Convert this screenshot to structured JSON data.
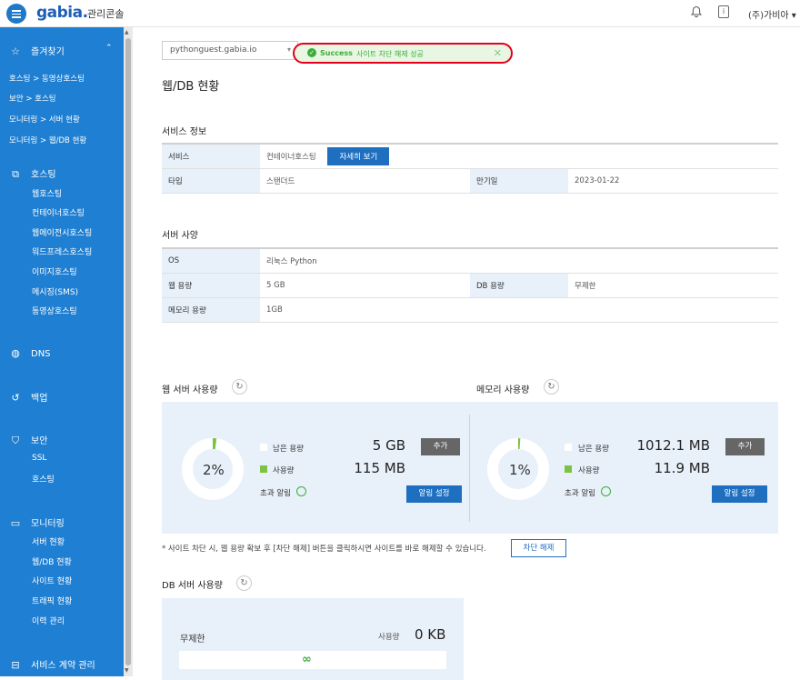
{
  "header": {
    "logo": "gabia.",
    "subtitle": "관리콘솔",
    "bell_icon": "bell-icon",
    "doc_icon": "document-icon",
    "company": "(주)가비아"
  },
  "sidebar": {
    "favorites": {
      "label": "즐겨찾기",
      "items": [
        "호스팅 > 동영상호스팅",
        "보안 > 호스팅",
        "모니터링 > 서버 현황",
        "모니터링 > 웹/DB 현황"
      ]
    },
    "hosting": {
      "label": "호스팅",
      "items": [
        "웹호스팅",
        "컨테이너호스팅",
        "웹에이전시호스팅",
        "워드프레스호스팅",
        "이미지호스팅",
        "메시징(SMS)",
        "동영상호스팅"
      ]
    },
    "dns": {
      "label": "DNS"
    },
    "backup": {
      "label": "백업"
    },
    "security": {
      "label": "보안",
      "items": [
        "SSL",
        "호스팅"
      ]
    },
    "monitoring": {
      "label": "모니터링",
      "items": [
        "서버 현황",
        "웹/DB 현황",
        "사이트 현황",
        "트래픽 현황",
        "이력 관리"
      ]
    },
    "contract": {
      "label": "서비스 계약 관리"
    }
  },
  "main": {
    "domain_select": "pythonguest.gabia.io",
    "toast": {
      "title": "Success",
      "message": "사이트 차단 해제 성공"
    },
    "page_title": "웹/DB 현황",
    "service_info": {
      "title": "서비스 정보",
      "service_label": "서비스",
      "service_value": "컨테이너호스팅",
      "detail_button": "자세히 보기",
      "type_label": "타입",
      "type_value": "스탠더드",
      "expire_label": "만기일",
      "expire_value": "2023-01-22"
    },
    "server_spec": {
      "title": "서버 사양",
      "os_label": "OS",
      "os_value": "리눅스 Python",
      "web_label": "웹 용량",
      "web_value": "5 GB",
      "db_label": "DB 용량",
      "db_value": "무제한",
      "mem_label": "메모리 용량",
      "mem_value": "1GB"
    },
    "web_usage": {
      "title": "웹 서버 사용량",
      "percent_label": "2%",
      "percent": 2,
      "remain_label": "남은 용량",
      "remain_value": "5 GB",
      "used_label": "사용량",
      "used_value": "115 MB",
      "alert_label": "초과 알림",
      "add_button": "추가",
      "alert_button": "알림 설정"
    },
    "mem_usage": {
      "title": "메모리 사용량",
      "percent_label": "1%",
      "percent": 1,
      "remain_label": "남은 용량",
      "remain_value": "1012.1 MB",
      "used_label": "사용량",
      "used_value": "11.9 MB",
      "alert_label": "초과 알림",
      "add_button": "추가",
      "alert_button": "알림 설정"
    },
    "note": "* 사이트 차단 시, 웹 용량 확보 후 [차단 해제] 버튼을 클릭하시면 사이트를 바로 해제할 수 있습니다.",
    "unblock_button": "차단 해제",
    "db_usage": {
      "title": "DB 서버 사용량",
      "capacity": "무제한",
      "used_label": "사용량",
      "used_value": "0 KB",
      "infinity": "∞"
    }
  },
  "colors": {
    "brand": "#1f7fd2",
    "accent": "#1f6fc0",
    "success": "#3cae3a",
    "highlight": "#e2001a"
  }
}
